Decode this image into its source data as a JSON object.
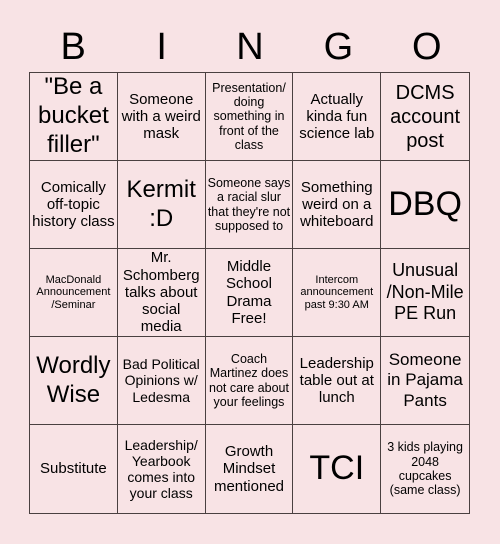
{
  "header": {
    "letters": [
      "B",
      "I",
      "N",
      "G",
      "O"
    ]
  },
  "cells": [
    {
      "text": "\"Be a bucket filler\""
    },
    {
      "text": "Someone with a weird mask"
    },
    {
      "text": "Presentation/ doing something in front of the class"
    },
    {
      "text": "Actually kinda fun science lab"
    },
    {
      "text": "DCMS account post"
    },
    {
      "text": "Comically off-topic history class"
    },
    {
      "text": "Kermit :D"
    },
    {
      "text": "Someone says a racial slur that they're not supposed to"
    },
    {
      "text": "Something weird on a whiteboard"
    },
    {
      "text": "DBQ"
    },
    {
      "text": "MacDonald Announcement /Seminar"
    },
    {
      "text": "Mr. Schomberg talks about social media"
    },
    {
      "text": "Middle School Drama Free!"
    },
    {
      "text": "Intercom announcement past 9:30 AM"
    },
    {
      "text": "Unusual /Non-Mile PE Run"
    },
    {
      "text": "Wordly Wise"
    },
    {
      "text": "Bad Political Opinions w/ Ledesma"
    },
    {
      "text": "Coach Martinez does not care about your feelings"
    },
    {
      "text": "Leadership table out at lunch"
    },
    {
      "text": "Someone in Pajama Pants"
    },
    {
      "text": "Substitute"
    },
    {
      "text": "Leadership/ Yearbook comes into your class"
    },
    {
      "text": "Growth Mindset mentioned"
    },
    {
      "text": "TCI"
    },
    {
      "text": "3 kids playing 2048 cupcakes (same class)"
    }
  ]
}
